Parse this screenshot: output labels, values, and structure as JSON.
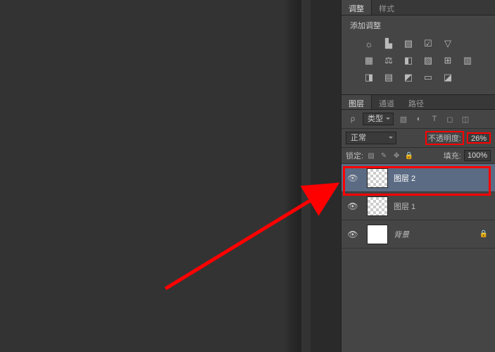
{
  "adjustPanel": {
    "tab1": "调整",
    "tab2": "样式",
    "header": "添加调整"
  },
  "layersPanel": {
    "tab1": "图层",
    "tab2": "通道",
    "tab3": "路径",
    "filterLabel": "类型",
    "blendMode": "正常",
    "opacityLabel": "不透明度:",
    "opacityValue": "26%",
    "lockLabel": "锁定:",
    "fillLabel": "填充:",
    "fillValue": "100%"
  },
  "layers": [
    {
      "name": "图层 2",
      "selected": true,
      "checker": true,
      "locked": false
    },
    {
      "name": "图层 1",
      "selected": false,
      "checker": true,
      "locked": false
    },
    {
      "name": "背景",
      "selected": false,
      "checker": false,
      "locked": true,
      "italic": true
    }
  ]
}
